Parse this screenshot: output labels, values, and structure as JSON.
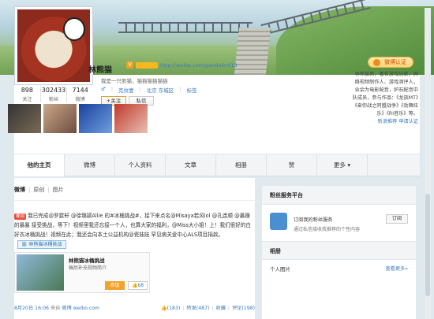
{
  "profile": {
    "name": "林熊猫",
    "v_badge": "V",
    "url": "http://weibo.com/pandalin013",
    "bio": "我是一只熊猫，猫猫猫猫猫猫",
    "gender_icon": "male-icon",
    "meta": [
      "克纹壹",
      "北京 东城区",
      "标签"
    ],
    "follow_label": "+关注",
    "message_label": "私信",
    "verify_label": "微博认证"
  },
  "stats": [
    {
      "num": "898",
      "label": "关注"
    },
    {
      "num": "302433",
      "label": "粉丝"
    },
    {
      "num": "7144",
      "label": "微博"
    }
  ],
  "intro_text": "林熊猫男，著名游戏玩家，网络视频制作人、游戏测评人，业余为电影配音，炉石配音中队成员，参与作品：《龙族MT》《奋你战之同盟战争》《劲舞炫乐》《RI音乐》等。",
  "intro_links": [
    "新浪推荐",
    "申请认证"
  ],
  "tabs": [
    "他的主页",
    "微博",
    "个人资料",
    "文章",
    "相册",
    "赞",
    "更多"
  ],
  "filters": {
    "all": "微博",
    "original": "原创",
    "pictures": "图片"
  },
  "post": {
    "tag": "要闻",
    "text": "我已完成@罗霆轩 @徐璐颖Allie 的#冰桶挑战#，接下来点名@Misaya若风lol @孔连顺 @暴躁的暴暴 接受挑战，等下！视频里我还忘接一个人，也算大家的福利，@Miss大小姐！上！我们很好的白好衣冰桶挑战！视频在此；我还会向本土公益机构@瓷娃娃 罕见病关爱中心ALS项目捐款。",
    "link_label": "林熊猫冰桶挑战"
  },
  "card": {
    "title": "林熊猫冰桶挑战",
    "sub": "稿后补充视频简介",
    "join": "参加",
    "likes": "68"
  },
  "footer": {
    "time": "8月20日 16:06",
    "source_prefix": "来自",
    "source": "微博 weibo.com",
    "actions": [
      "(183)",
      "转发(487)",
      "收藏",
      "评论(198)"
    ]
  },
  "side": {
    "service_header": "粉丝服务平台",
    "service_title": "订阅我的粉丝服务",
    "service_desc": "通过私信接收我推荐的个性内容",
    "subscribe": "订阅",
    "album_header": "相册",
    "photos_label": "个人图片",
    "photos_more": "查看更多»"
  }
}
